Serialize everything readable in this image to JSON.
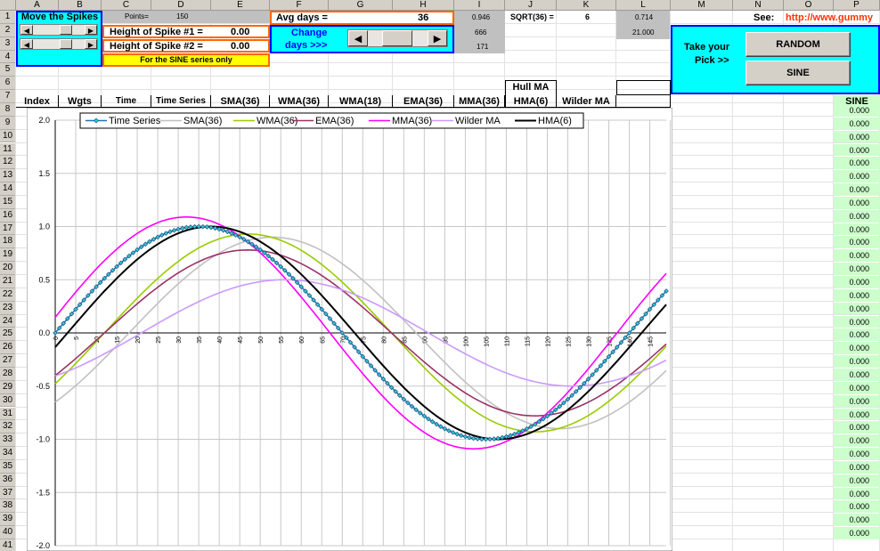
{
  "columns": [
    "A",
    "B",
    "C",
    "D",
    "E",
    "F",
    "G",
    "H",
    "I",
    "J",
    "K",
    "L",
    "M",
    "N",
    "O",
    "P"
  ],
  "rows": [
    "1",
    "2",
    "3",
    "4",
    "5",
    "6",
    "7",
    "8",
    "9",
    "10",
    "11",
    "12",
    "13",
    "14",
    "15",
    "16",
    "17",
    "18",
    "19",
    "20",
    "21",
    "22",
    "23",
    "24",
    "25",
    "26",
    "27",
    "28",
    "29",
    "30",
    "31",
    "32",
    "33",
    "34",
    "35",
    "36",
    "37",
    "38",
    "39",
    "40",
    "41"
  ],
  "controls": {
    "move_spikes_label": "Move the Spikes",
    "points_label": "Points=",
    "points_value": "150",
    "spike1_label": "Height of Spike #1 =",
    "spike1_value": "0.00",
    "spike2_label": "Height of Spike #2 =",
    "spike2_value": "0.00",
    "sine_only_note": "For the SINE series only",
    "avg_days_label": "Avg days =",
    "avg_days_value": "36",
    "change_days_label_1": "Change",
    "change_days_label_2": "days >>>",
    "sqrt_label": "SQRT(36) =",
    "sqrt_value": "6",
    "i1": "0.946",
    "i2": "666",
    "i3": "171",
    "l1": "0.714",
    "l2": "21.000",
    "see_label": "See:",
    "see_link": "http://www.gummy",
    "take_pick_1": "Take your",
    "take_pick_2": "Pick >>",
    "random_button": "RANDOM",
    "sine_button": "SINE"
  },
  "headers": {
    "index": "Index",
    "wgts": "Wgts",
    "time": "Time",
    "time_series": "Time Series",
    "sma": "SMA(36)",
    "wma36": "WMA(36)",
    "wma18": "WMA(18)",
    "ema": "EMA(36)",
    "mma": "MMA(36)",
    "hull_ma": "Hull MA",
    "hma": "HMA(6)",
    "wilder": "Wilder MA",
    "sine": "SINE"
  },
  "sine_values": [
    "0.000",
    "0.000",
    "0.000",
    "0.000",
    "0.000",
    "0.000",
    "0.000",
    "0.000",
    "0.000",
    "0.000",
    "0.000",
    "0.000",
    "0.000",
    "0.000",
    "0.000",
    "0.000",
    "0.000",
    "0.000",
    "0.000",
    "0.000",
    "0.000",
    "0.000",
    "0.000",
    "0.000",
    "0.000",
    "0.000",
    "0.000",
    "0.000",
    "0.000",
    "0.000",
    "0.000",
    "0.000",
    "0.000"
  ],
  "chart_data": {
    "type": "line",
    "ylim": [
      -2.0,
      2.0
    ],
    "xlim": [
      0,
      149
    ],
    "y_ticks": [
      "2.0",
      "1.5",
      "1.0",
      "0.5",
      "0.0",
      "-0.5",
      "-1.0",
      "-1.5",
      "-2.0"
    ],
    "x_ticks": [
      "0",
      "5",
      "10",
      "15",
      "20",
      "25",
      "30",
      "35",
      "40",
      "45",
      "50",
      "55",
      "60",
      "65",
      "70",
      "75",
      "80",
      "85",
      "90",
      "95",
      "100",
      "105",
      "110",
      "115",
      "120",
      "125",
      "130",
      "135",
      "140",
      "145"
    ],
    "series": [
      {
        "name": "Time Series",
        "color": "#1f77b4",
        "marker": "diamond",
        "formula": "sin(2*pi*t/140)",
        "amplitude": 1.0,
        "lag": 0,
        "offset_phase": 0
      },
      {
        "name": "SMA(36)",
        "color": "#c0c0c0",
        "amplitude": 0.9,
        "lag": 18
      },
      {
        "name": "WMA(36)",
        "color": "#99cc00",
        "amplitude": 0.93,
        "lag": 12
      },
      {
        "name": "EMA(36)",
        "color": "#993366",
        "amplitude": 0.78,
        "lag": 12
      },
      {
        "name": "MMA(36)",
        "color": "#ff00ff",
        "amplitude": 1.09,
        "lag": -3
      },
      {
        "name": "Wilder MA",
        "color": "#cc99ff",
        "amplitude": 0.5,
        "lag": 21
      },
      {
        "name": "HMA(6)",
        "color": "#000000",
        "amplitude": 1.0,
        "lag": 3
      }
    ],
    "legend_position": "top",
    "grid": true
  }
}
